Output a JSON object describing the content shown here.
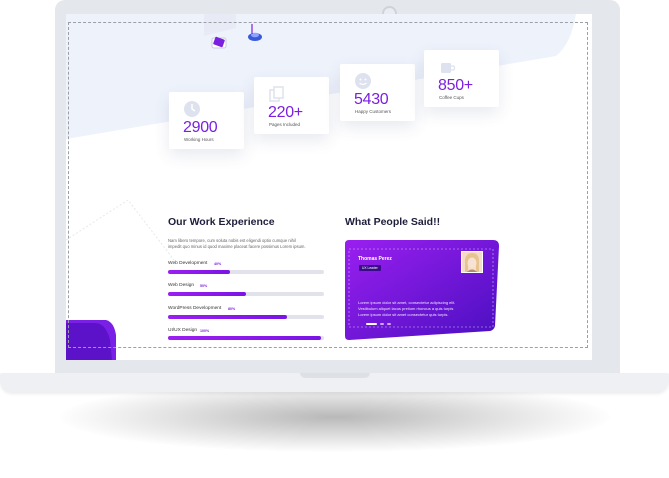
{
  "stats": [
    {
      "icon": "clock-icon",
      "number": "2900",
      "label": "Working Hours"
    },
    {
      "icon": "pages-icon",
      "number": "220+",
      "label": "Pages Included"
    },
    {
      "icon": "smile-icon",
      "number": "5430",
      "label": "Happy Customers"
    },
    {
      "icon": "coffee-cup-icon",
      "number": "850+",
      "label": "Coffee Cups"
    }
  ],
  "experience": {
    "title": "Our Work  Experience",
    "paragraph_lines": [
      "Nam libero tempore, cum soluta nobis est eligendi optio cumque nihil",
      "impedit quo minus id quod maxime placeat facere possimus Lorem ipsum."
    ],
    "skills": [
      {
        "label": "Web Development",
        "percent": "40%",
        "level": 0.4
      },
      {
        "label": "Web Design",
        "percent": "50%",
        "level": 0.5
      },
      {
        "label": "WordPress Development",
        "percent": "80%",
        "level": 0.76
      },
      {
        "label": "UI/UX Design",
        "percent": "100%",
        "level": 0.98
      }
    ]
  },
  "testimonials": {
    "title": "What People Said!!",
    "name": "Thomas Perez",
    "role": "UX Leader",
    "text_lines": [
      "Lorem ipsum dolor sit amet, consectetur adipiscing elit.",
      "Vestibulum aliquet lacus pretium rhoncus a quis turpis",
      "Lorem ipsum dolor sit amet consectetur quis turpis."
    ],
    "active_dot": 0
  },
  "colors": {
    "accent": "#7b1fe0",
    "testimonial_gradient": [
      "#9b1ff0",
      "#4a0fc0"
    ],
    "hero_bg": "#eef2fb",
    "device": "#e4e7ec"
  }
}
